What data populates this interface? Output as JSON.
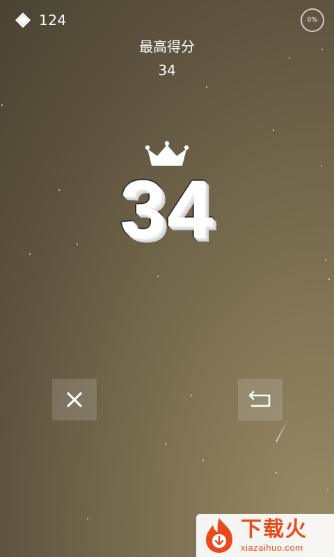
{
  "hud": {
    "gem_icon": "diamond-icon",
    "gem_count": "124",
    "progress_label": "0%",
    "progress_value": 0
  },
  "best": {
    "label": "最高得分",
    "value": "34"
  },
  "result": {
    "crown_icon": "crown-icon",
    "score": "34"
  },
  "controls": {
    "close_icon": "close-icon",
    "back_icon": "return-arrow-icon"
  },
  "watermark": {
    "title": "下载火",
    "site": "xiazaihuo.com",
    "brand_color": "#e84a1c"
  },
  "colors": {
    "background_dark": "#4a4332",
    "background_light": "#978a66",
    "text": "#ffffff"
  }
}
